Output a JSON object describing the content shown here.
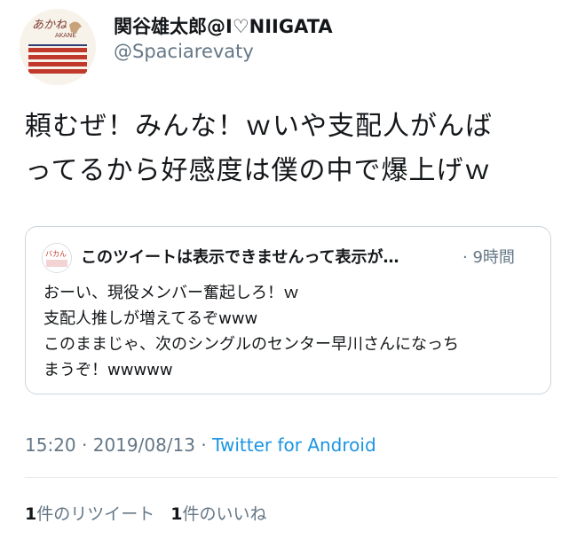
{
  "author": {
    "display_name": "関谷雄太郎@I♡NIIGATA",
    "handle": "@Spaciarevaty",
    "avatar_text": "あかね",
    "avatar_subtext": "AKANE"
  },
  "tweet": {
    "lines": [
      "頼むぜ！みんな！ｗいや支配人がんば",
      "ってるから好感度は僕の中で爆上げｗ"
    ]
  },
  "quoted": {
    "avatar_text": "バカん",
    "name": "このツイートは表示できませんって表示が…",
    "time": "· 9時間",
    "lines": [
      "おーい、現役メンバー奮起しろ！ｗ",
      "支配人推しが増えてるぞwww",
      "このままじゃ、次のシングルのセンター早川さんになっち",
      "まうぞ！wwwww"
    ]
  },
  "meta": {
    "time": "15:20",
    "sep1": " · ",
    "date": "2019/08/13",
    "sep2": " · ",
    "source": "Twitter for Android"
  },
  "stats": {
    "retweet_count": "1",
    "retweet_label": "件のリツイート",
    "like_count": "1",
    "like_label": "件のいいね"
  },
  "colors": {
    "link": "#1b95e0",
    "secondary": "#657786",
    "border": "#ccd6dd"
  }
}
